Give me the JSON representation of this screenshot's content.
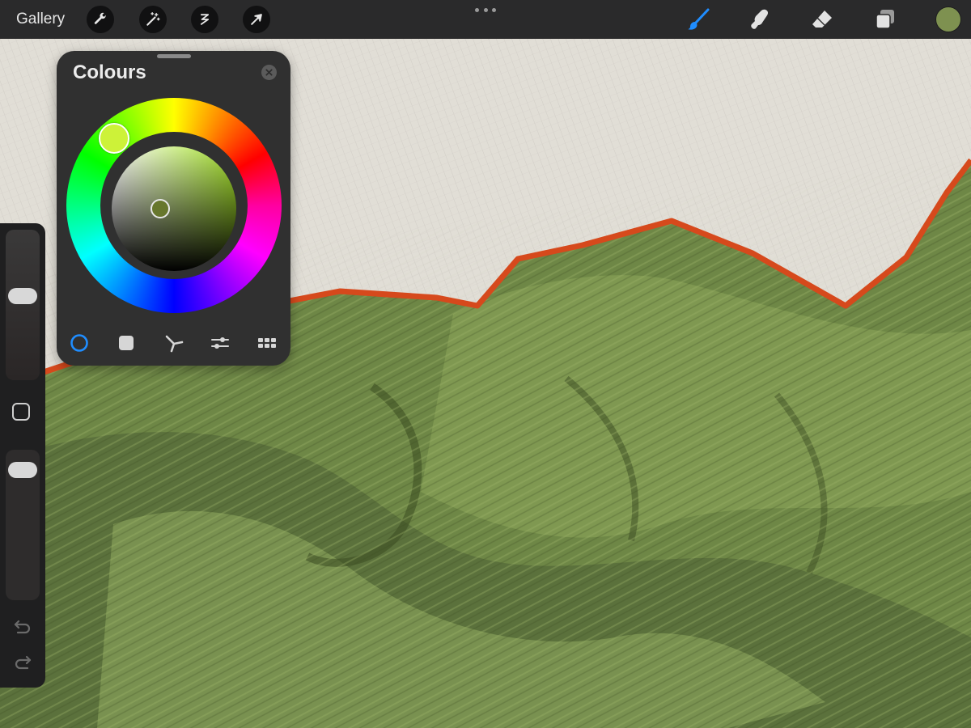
{
  "toolbar": {
    "gallery_label": "Gallery",
    "left_tools": [
      "actions-icon",
      "adjustments-icon",
      "selection-icon",
      "transform-icon"
    ],
    "right_tools": [
      "brush-icon",
      "smudge-icon",
      "eraser-icon",
      "layers-icon"
    ],
    "active_tool": "brush",
    "current_colour": "#7e9150",
    "active_accent": "#1f8dff"
  },
  "sidebar": {
    "brush_size": 0.57,
    "opacity": 0.93
  },
  "colour_panel": {
    "title": "Colours",
    "selected_hue_colour": "#cdf238",
    "selected_colour": "#67772d",
    "modes": [
      "disc",
      "classic",
      "harmony",
      "value",
      "palettes"
    ],
    "active_mode": "disc"
  },
  "canvas": {
    "sky_colour": "#e1ddd6",
    "ridge_colour": "#d6491c",
    "hill_colour": "#6e8746"
  }
}
